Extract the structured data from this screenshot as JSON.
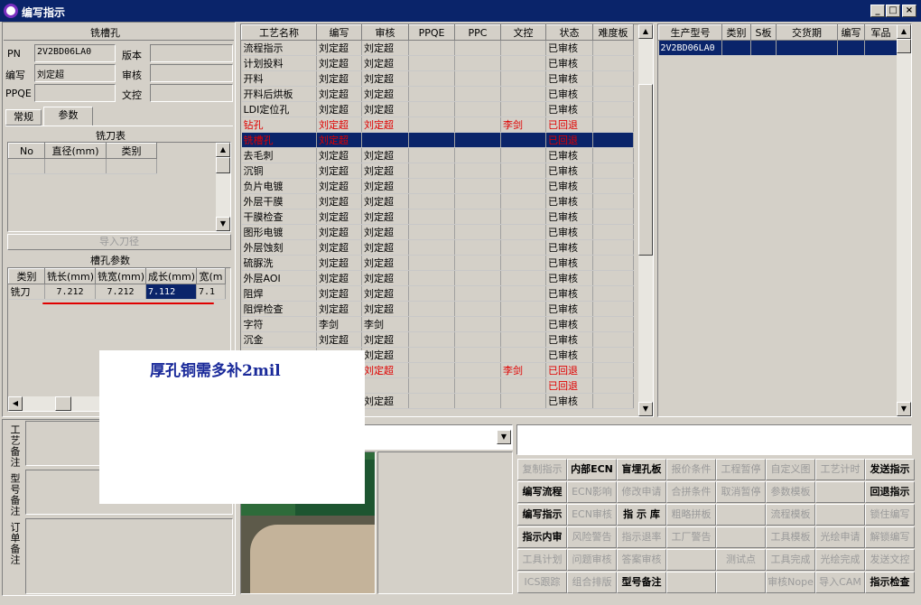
{
  "window": {
    "title": "编写指示",
    "min": "_",
    "max": "□",
    "close": "×"
  },
  "left": {
    "section_title": "铣槽孔",
    "pn_label": "PN",
    "pn_value": "2V2BD06LA0",
    "version_label": "版本",
    "version_value": "",
    "writer_label": "编写",
    "writer_value": "刘定超",
    "review_label": "审核",
    "review_value": "",
    "ppqe_label": "PPQE",
    "ppqe_value": "",
    "docctl_label": "文控",
    "docctl_value": "",
    "tabs": [
      "常规",
      "参数"
    ],
    "cutter_title": "铣刀表",
    "cutter_headers": [
      "No",
      "直径(mm)",
      "类别"
    ],
    "import_btn": "导入刀径",
    "slot_title": "槽孔参数",
    "slot_headers": [
      "类别",
      "铣长(mm)",
      "铣宽(mm)",
      "成长(mm)",
      "宽(m"
    ],
    "slot_rows": [
      [
        "铣刀",
        "7.212",
        "7.212",
        "7.112",
        "7.1"
      ]
    ],
    "notes": [
      "工艺备注",
      "型号备注",
      "订单备注"
    ]
  },
  "process": {
    "headers": [
      "工艺名称",
      "编写",
      "审核",
      "PPQE",
      "PPC",
      "文控",
      "状态",
      "难度板"
    ],
    "rows": [
      {
        "name": "流程指示",
        "writer": "刘定超",
        "review": "刘定超",
        "ppqe": "",
        "ppc": "",
        "doc": "",
        "status": "已审核",
        "red": false,
        "selected": false
      },
      {
        "name": "计划投料",
        "writer": "刘定超",
        "review": "刘定超",
        "ppqe": "",
        "ppc": "",
        "doc": "",
        "status": "已审核",
        "red": false,
        "selected": false
      },
      {
        "name": "开料",
        "writer": "刘定超",
        "review": "刘定超",
        "ppqe": "",
        "ppc": "",
        "doc": "",
        "status": "已审核",
        "red": false,
        "selected": false
      },
      {
        "name": "开料后烘板",
        "writer": "刘定超",
        "review": "刘定超",
        "ppqe": "",
        "ppc": "",
        "doc": "",
        "status": "已审核",
        "red": false,
        "selected": false
      },
      {
        "name": "LDI定位孔",
        "writer": "刘定超",
        "review": "刘定超",
        "ppqe": "",
        "ppc": "",
        "doc": "",
        "status": "已审核",
        "red": false,
        "selected": false
      },
      {
        "name": "钻孔",
        "writer": "刘定超",
        "review": "刘定超",
        "ppqe": "",
        "ppc": "",
        "doc": "李剑",
        "status": "已回退",
        "red": true,
        "selected": false
      },
      {
        "name": "铣槽孔",
        "writer": "刘定超",
        "review": "",
        "ppqe": "",
        "ppc": "",
        "doc": "",
        "status": "已回退",
        "red": true,
        "selected": true
      },
      {
        "name": "去毛刺",
        "writer": "刘定超",
        "review": "刘定超",
        "ppqe": "",
        "ppc": "",
        "doc": "",
        "status": "已审核",
        "red": false,
        "selected": false
      },
      {
        "name": "沉铜",
        "writer": "刘定超",
        "review": "刘定超",
        "ppqe": "",
        "ppc": "",
        "doc": "",
        "status": "已审核",
        "red": false,
        "selected": false
      },
      {
        "name": "负片电镀",
        "writer": "刘定超",
        "review": "刘定超",
        "ppqe": "",
        "ppc": "",
        "doc": "",
        "status": "已审核",
        "red": false,
        "selected": false
      },
      {
        "name": "外层干膜",
        "writer": "刘定超",
        "review": "刘定超",
        "ppqe": "",
        "ppc": "",
        "doc": "",
        "status": "已审核",
        "red": false,
        "selected": false
      },
      {
        "name": "干膜检查",
        "writer": "刘定超",
        "review": "刘定超",
        "ppqe": "",
        "ppc": "",
        "doc": "",
        "status": "已审核",
        "red": false,
        "selected": false
      },
      {
        "name": "图形电镀",
        "writer": "刘定超",
        "review": "刘定超",
        "ppqe": "",
        "ppc": "",
        "doc": "",
        "status": "已审核",
        "red": false,
        "selected": false
      },
      {
        "name": "外层蚀刻",
        "writer": "刘定超",
        "review": "刘定超",
        "ppqe": "",
        "ppc": "",
        "doc": "",
        "status": "已审核",
        "red": false,
        "selected": false
      },
      {
        "name": "硫脲洗",
        "writer": "刘定超",
        "review": "刘定超",
        "ppqe": "",
        "ppc": "",
        "doc": "",
        "status": "已审核",
        "red": false,
        "selected": false
      },
      {
        "name": "外层AOI",
        "writer": "刘定超",
        "review": "刘定超",
        "ppqe": "",
        "ppc": "",
        "doc": "",
        "status": "已审核",
        "red": false,
        "selected": false
      },
      {
        "name": "阻焊",
        "writer": "刘定超",
        "review": "刘定超",
        "ppqe": "",
        "ppc": "",
        "doc": "",
        "status": "已审核",
        "red": false,
        "selected": false
      },
      {
        "name": "阻焊检查",
        "writer": "刘定超",
        "review": "刘定超",
        "ppqe": "",
        "ppc": "",
        "doc": "",
        "status": "已审核",
        "red": false,
        "selected": false
      },
      {
        "name": "字符",
        "writer": "李剑",
        "review": "李剑",
        "ppqe": "",
        "ppc": "",
        "doc": "",
        "status": "已审核",
        "red": false,
        "selected": false
      },
      {
        "name": "沉金",
        "writer": "刘定超",
        "review": "刘定超",
        "ppqe": "",
        "ppc": "",
        "doc": "",
        "status": "已审核",
        "red": false,
        "selected": false
      },
      {
        "name": "",
        "writer": "",
        "review": "刘定超",
        "ppqe": "",
        "ppc": "",
        "doc": "",
        "status": "已审核",
        "red": false,
        "selected": false
      },
      {
        "name": "",
        "writer": "",
        "review": "刘定超",
        "ppqe": "",
        "ppc": "",
        "doc": "李剑",
        "status": "已回退",
        "red": true,
        "selected": false
      },
      {
        "name": "",
        "writer": "",
        "review": "",
        "ppqe": "",
        "ppc": "",
        "doc": "",
        "status": "已回退",
        "red": true,
        "selected": false
      },
      {
        "name": "",
        "writer": "",
        "review": "刘定超",
        "ppqe": "",
        "ppc": "",
        "doc": "",
        "status": "已审核",
        "red": false,
        "selected": false
      }
    ]
  },
  "product": {
    "headers": [
      "生产型号",
      "类别",
      "S板",
      "交货期",
      "编写",
      "军品"
    ],
    "rows": [
      [
        "2V2BD06LA0",
        "",
        "",
        "",
        "",
        ""
      ]
    ]
  },
  "overlay_note": "厚孔铜需多补2mil",
  "buttons": [
    [
      {
        "t": "复制指示",
        "e": false
      },
      {
        "t": "内部ECN",
        "e": true
      },
      {
        "t": "盲埋孔板",
        "e": true
      },
      {
        "t": "报价条件",
        "e": false
      },
      {
        "t": "工程暂停",
        "e": false
      },
      {
        "t": "自定义图",
        "e": false
      },
      {
        "t": "工艺计时",
        "e": false
      },
      {
        "t": "发送指示",
        "e": true
      }
    ],
    [
      {
        "t": "编写流程",
        "e": true
      },
      {
        "t": "ECN影响",
        "e": false
      },
      {
        "t": "修改申请",
        "e": false
      },
      {
        "t": "合拼条件",
        "e": false
      },
      {
        "t": "取消暂停",
        "e": false
      },
      {
        "t": "参数模板",
        "e": false
      },
      {
        "t": "",
        "e": false
      },
      {
        "t": "回退指示",
        "e": true
      }
    ],
    [
      {
        "t": "编写指示",
        "e": true
      },
      {
        "t": "ECN审核",
        "e": false
      },
      {
        "t": "指 示 库",
        "e": true
      },
      {
        "t": "粗略拼板",
        "e": false
      },
      {
        "t": "",
        "e": false
      },
      {
        "t": "流程模板",
        "e": false
      },
      {
        "t": "",
        "e": false
      },
      {
        "t": "锁住编写",
        "e": false
      }
    ],
    [
      {
        "t": "指示内审",
        "e": true
      },
      {
        "t": "风险警告",
        "e": false
      },
      {
        "t": "指示退率",
        "e": false
      },
      {
        "t": "工厂警告",
        "e": false
      },
      {
        "t": "",
        "e": false
      },
      {
        "t": "工具模板",
        "e": false
      },
      {
        "t": "光绘申请",
        "e": false
      },
      {
        "t": "解锁编写",
        "e": false
      }
    ],
    [
      {
        "t": "工具计划",
        "e": false
      },
      {
        "t": "问题审核",
        "e": false
      },
      {
        "t": "答案审核",
        "e": false
      },
      {
        "t": "",
        "e": false
      },
      {
        "t": "测试点",
        "e": false
      },
      {
        "t": "工具完成",
        "e": false
      },
      {
        "t": "光绘完成",
        "e": false
      },
      {
        "t": "发送文控",
        "e": false
      }
    ],
    [
      {
        "t": "ICS跟踪",
        "e": false
      },
      {
        "t": "组合排版",
        "e": false
      },
      {
        "t": "型号备注",
        "e": true
      },
      {
        "t": "",
        "e": false
      },
      {
        "t": "",
        "e": false
      },
      {
        "t": "审核Nope",
        "e": false
      },
      {
        "t": "导入CAM",
        "e": false
      },
      {
        "t": "指示检查",
        "e": true
      }
    ]
  ]
}
